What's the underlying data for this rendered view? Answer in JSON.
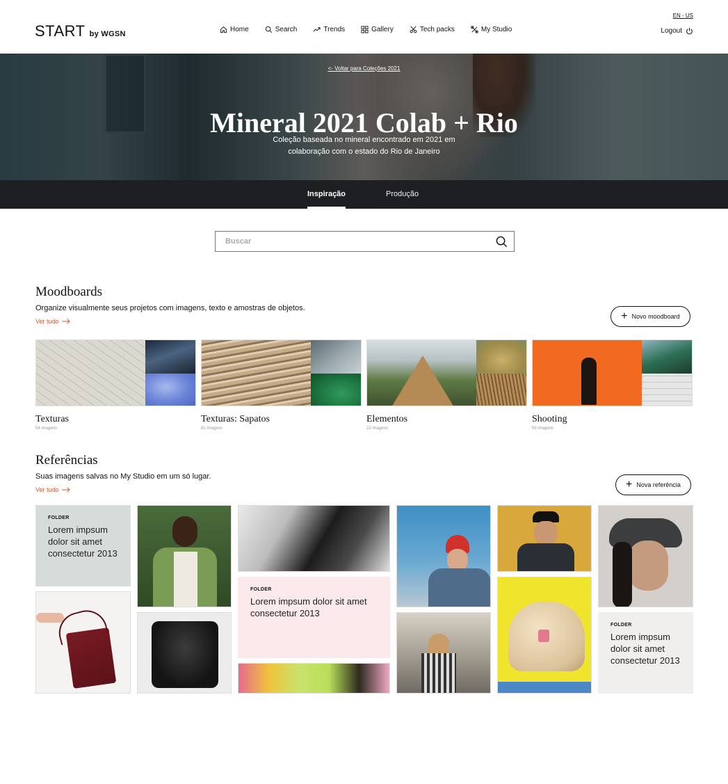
{
  "header": {
    "logo_main": "START",
    "logo_sub": "by WGSN",
    "nav": [
      {
        "label": "Home",
        "icon": "home-icon"
      },
      {
        "label": "Search",
        "icon": "search-icon"
      },
      {
        "label": "Trends",
        "icon": "trend-icon"
      },
      {
        "label": "Gallery",
        "icon": "grid-icon"
      },
      {
        "label": "Tech packs",
        "icon": "scissors-icon"
      },
      {
        "label": "My Studio",
        "icon": "studio-icon"
      }
    ],
    "lang": "EN - US",
    "logout": "Logout"
  },
  "hero": {
    "back_link": "<- Voltar para Coleções 2021",
    "title": "Mineral 2021 Colab + Rio",
    "subtitle_line1": "Coleção baseada no mineral encontrado em 2021 em",
    "subtitle_line2": "colaboração com o estado do Rio de Janeiro"
  },
  "tabs": [
    {
      "label": "Inspiração",
      "active": true
    },
    {
      "label": "Produção",
      "active": false
    }
  ],
  "search": {
    "placeholder": "Buscar",
    "value": ""
  },
  "moodboards": {
    "title": "Moodboards",
    "description": "Organize visualmente seus projetos com imagens, texto e amostras de objetos.",
    "see_all": "Ver tudo",
    "new_button": "Novo moodboard",
    "items": [
      {
        "name": "Texturas",
        "count": "54 imagens"
      },
      {
        "name": "Texturas: Sapatos",
        "count": "81 imagens"
      },
      {
        "name": "Elementos",
        "count": "22 imagens"
      },
      {
        "name": "Shooting",
        "count": "59 imagens"
      }
    ]
  },
  "references": {
    "title": "Referências",
    "description": "Suas imagens salvas no My Studio em um só lugar.",
    "see_all": "Ver tudo",
    "new_button": "Nova referência",
    "folders": [
      {
        "tag": "FOLDER",
        "text": "Lorem impsum dolor sit amet consectetur 2013"
      },
      {
        "tag": "FOLDER",
        "text": "Lorem impsum dolor sit amet consectetur 2013"
      },
      {
        "tag": "FOLDER",
        "text": "Lorem impsum dolor sit amet consectetur 2013"
      }
    ]
  },
  "colors": {
    "accent": "#d35a3a",
    "dark_bar": "#1d1f23",
    "folder_gray": "#d6dcd9",
    "folder_pink": "#fbe9ec",
    "folder_light": "#f1efee"
  }
}
